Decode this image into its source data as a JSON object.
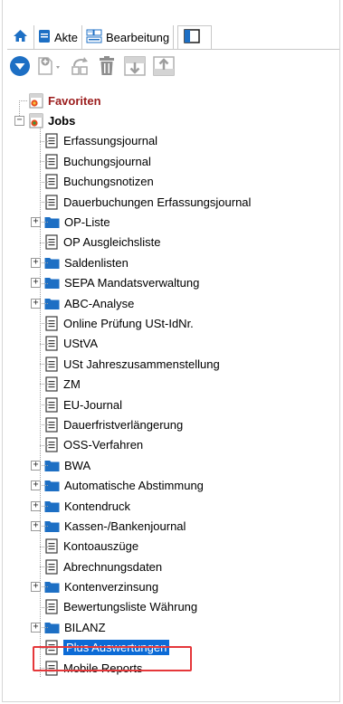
{
  "tabs": {
    "home_icon": "home-icon",
    "items": [
      {
        "label": "Akte",
        "icon": "file-icon"
      },
      {
        "label": "Bearbeitung",
        "icon": "edit-list-icon"
      },
      {
        "label": "",
        "icon": "panel-icon"
      }
    ]
  },
  "toolbar": {
    "icons": [
      "dropdown-menu-icon",
      "add-icon",
      "move-icon",
      "delete-icon",
      "move-down-icon",
      "move-up-icon"
    ]
  },
  "tree": {
    "root": [
      {
        "label": "Favoriten",
        "icon": "favorites-icon"
      },
      {
        "label": "Jobs",
        "icon": "jobs-icon"
      }
    ],
    "children": [
      {
        "label": "Erfassungsjournal",
        "type": "doc"
      },
      {
        "label": "Buchungsjournal",
        "type": "doc"
      },
      {
        "label": "Buchungsnotizen",
        "type": "doc"
      },
      {
        "label": "Dauerbuchungen Erfassungsjournal",
        "type": "doc"
      },
      {
        "label": "OP-Liste",
        "type": "folder"
      },
      {
        "label": "OP Ausgleichsliste",
        "type": "doc"
      },
      {
        "label": "Saldenlisten",
        "type": "folder"
      },
      {
        "label": "SEPA Mandatsverwaltung",
        "type": "folder"
      },
      {
        "label": "ABC-Analyse",
        "type": "folder"
      },
      {
        "label": "Online Prüfung USt-IdNr.",
        "type": "doc"
      },
      {
        "label": "UStVA",
        "type": "doc"
      },
      {
        "label": "USt Jahreszusammenstellung",
        "type": "doc"
      },
      {
        "label": "ZM",
        "type": "doc"
      },
      {
        "label": "EU-Journal",
        "type": "doc"
      },
      {
        "label": "Dauerfristverlängerung",
        "type": "doc"
      },
      {
        "label": "OSS-Verfahren",
        "type": "doc"
      },
      {
        "label": "BWA",
        "type": "folder"
      },
      {
        "label": "Automatische Abstimmung",
        "type": "folder"
      },
      {
        "label": "Kontendruck",
        "type": "folder"
      },
      {
        "label": "Kassen-/Bankenjournal",
        "type": "folder"
      },
      {
        "label": "Kontoauszüge",
        "type": "doc"
      },
      {
        "label": "Abrechnungsdaten",
        "type": "doc"
      },
      {
        "label": "Kontenverzinsung",
        "type": "folder"
      },
      {
        "label": "Bewertungsliste Währung",
        "type": "doc"
      },
      {
        "label": "BILANZ",
        "type": "folder"
      },
      {
        "label": "Plus Auswertungen",
        "type": "doc",
        "selected": true
      },
      {
        "label": "Mobile Reports",
        "type": "doc"
      }
    ]
  },
  "colors": {
    "folder": "#1d6fc4",
    "selection": "#0c6bd6",
    "favorites_text": "#9b1c1c",
    "highlight_box": "#e5373a"
  }
}
